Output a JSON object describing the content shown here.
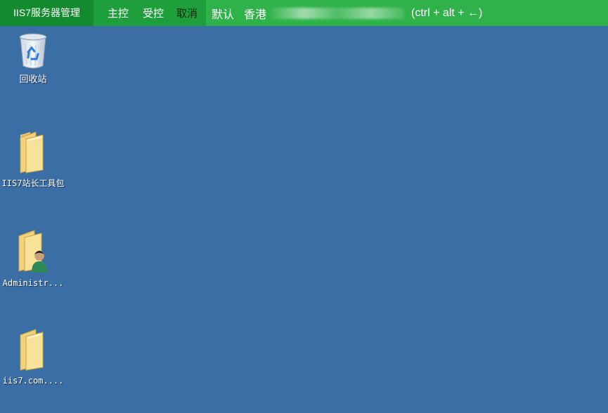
{
  "topbar": {
    "brand": "IIS7服务器管理",
    "actions": {
      "master": "主控",
      "controlled": "受控",
      "cancel": "取消"
    },
    "profile": "默认",
    "region": "香港",
    "shortcut_hint": "(ctrl + alt + ←)"
  },
  "desktop": {
    "icons": [
      {
        "label": "回收站",
        "icon": "recycle-bin-icon"
      },
      {
        "label": "IIS7站长工具包",
        "icon": "folder-icon"
      },
      {
        "label": "Administr...",
        "icon": "user-folder-icon"
      },
      {
        "label": "iis7.com....",
        "icon": "folder-icon"
      }
    ]
  },
  "colors": {
    "desktop_bg": "#3a6ea5",
    "bar_green": "#2fb24a",
    "brand_green": "#138a2e"
  }
}
